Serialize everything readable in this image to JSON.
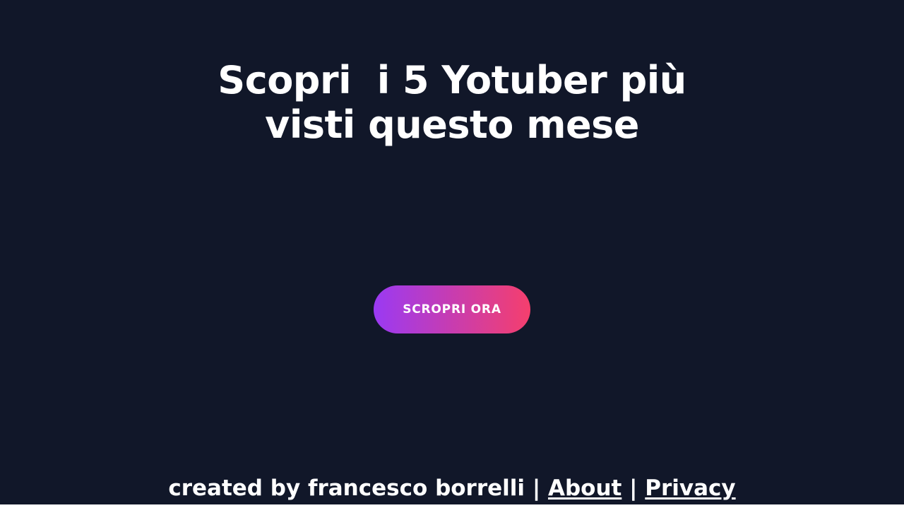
{
  "hero": {
    "title_line1": "Scopri  i 5 Yotuber più",
    "title_line2": "visti questo mese",
    "cta_label": "SCROPRI ORA"
  },
  "footer": {
    "credit": "created by francesco borrelli",
    "separator1": " | ",
    "about_label": "About",
    "separator2": " | ",
    "privacy_label": "Privacy"
  },
  "colors": {
    "background": "#111729",
    "text": "#ffffff",
    "cta_gradient_start": "#9a3af3",
    "cta_gradient_end": "#f53f6d"
  }
}
